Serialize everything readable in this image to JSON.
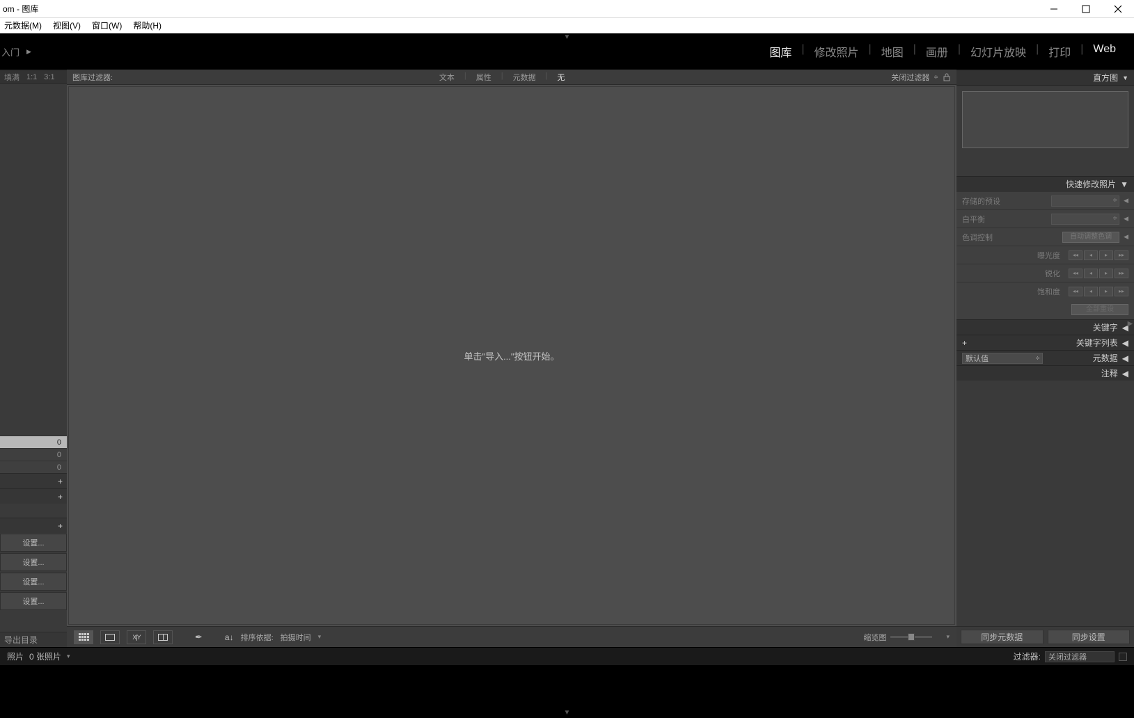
{
  "window": {
    "title": "om - 图库"
  },
  "menu": {
    "metadata": "元数据(M)",
    "view": "视图(V)",
    "window": "窗口(W)",
    "help": "帮助(H)"
  },
  "topbar": {
    "left": "入门",
    "play": "▶"
  },
  "modes": {
    "library": "图库",
    "develop": "修改照片",
    "map": "地图",
    "book": "画册",
    "slideshow": "幻灯片放映",
    "print": "打印",
    "web": "Web"
  },
  "left": {
    "zoom": {
      "fill": "填满",
      "r1": "1:1",
      "r2": "3:1"
    },
    "counts": {
      "a": "0",
      "b": "0",
      "c": "0"
    },
    "setting": "设置...",
    "export": "导出目录"
  },
  "filter": {
    "label": "图库过滤器:",
    "text": "文本",
    "attr": "属性",
    "meta": "元数据",
    "none": "无",
    "close": "关闭过滤器"
  },
  "viewport": {
    "msg": "单击\"导入...\"按钮开始。"
  },
  "toolbar": {
    "sort_label": "排序依据:",
    "sort_value": "拍摄时间",
    "thumb_label": "缩览图"
  },
  "right": {
    "histogram": "直方图",
    "quickdev": "快速修改照片",
    "preset_label": "存储的预设",
    "wb_label": "白平衡",
    "tone_label": "色调控制",
    "auto_tone": "自动调整色调",
    "exposure": "曝光度",
    "sharpen": "锐化",
    "saturation": "饱和度",
    "reset": "全部重设",
    "keywords": "关键字",
    "keyword_list": "关键字列表",
    "metadata": "元数据",
    "meta_default": "默认值",
    "comment": "注释",
    "sync_meta": "同步元数据",
    "sync_settings": "同步设置"
  },
  "film": {
    "photos": "照片",
    "count": "0 张照片",
    "filter_label": "过滤器:",
    "filter_value": "关闭过滤器"
  }
}
